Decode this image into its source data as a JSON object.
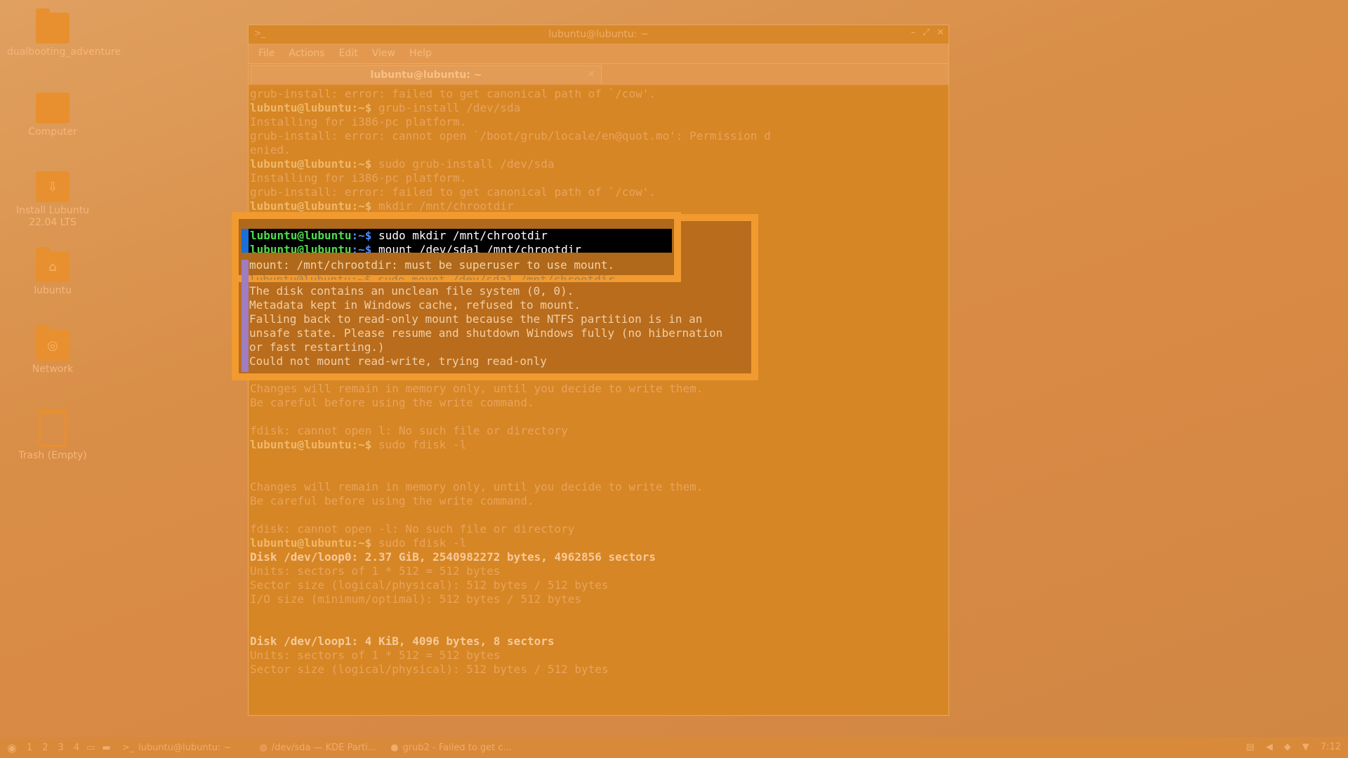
{
  "desktop": {
    "icons": [
      {
        "label": "dualbooting_adventure",
        "icon": "folder-icon"
      },
      {
        "label": "Computer",
        "icon": "computer-icon"
      },
      {
        "label": "Install Lubuntu 22.04 LTS",
        "icon": "installer-icon"
      },
      {
        "label": "lubuntu",
        "icon": "home-folder-icon"
      },
      {
        "label": "Network",
        "icon": "network-icon"
      },
      {
        "label": "Trash (Empty)",
        "icon": "trash-icon"
      }
    ]
  },
  "window": {
    "title": "lubuntu@lubuntu: ~",
    "menu": [
      "File",
      "Actions",
      "Edit",
      "View",
      "Help"
    ],
    "tab_label": "lubuntu@lubuntu: ~"
  },
  "terminal": {
    "prompt": "lubuntu@lubuntu:~$",
    "lines": [
      {
        "t": "grub-install: error: failed to get canonical path of `/cow'."
      },
      {
        "t": "lubuntu@lubuntu:~$ grub-install /dev/sda",
        "p": true
      },
      {
        "t": "Installing for i386-pc platform."
      },
      {
        "t": "grub-install: error: cannot open `/boot/grub/locale/en@quot.mo': Permission d"
      },
      {
        "t": "enied."
      },
      {
        "t": "lubuntu@lubuntu:~$ sudo grub-install /dev/sda",
        "p": true
      },
      {
        "t": "Installing for i386-pc platform."
      },
      {
        "t": "grub-install: error: failed to get canonical path of `/cow'."
      },
      {
        "t": "lubuntu@lubuntu:~$ mkdir /mnt/chrootdir",
        "p": true
      },
      {
        "t": ""
      },
      {
        "t": ""
      },
      {
        "t": ""
      },
      {
        "t": ""
      },
      {
        "t": ""
      },
      {
        "t": ""
      },
      {
        "t": ""
      },
      {
        "t": ""
      },
      {
        "t": ""
      },
      {
        "t": ""
      },
      {
        "t": ""
      },
      {
        "t": ""
      },
      {
        "t": "Changes will remain in memory only, until you decide to write them."
      },
      {
        "t": "Be careful before using the write command."
      },
      {
        "t": ""
      },
      {
        "t": "fdisk: cannot open l: No such file or directory"
      },
      {
        "t": "lubuntu@lubuntu:~$ sudo fdisk -l",
        "p": true
      },
      {
        "t": ""
      },
      {
        "t": ""
      },
      {
        "t": "Changes will remain in memory only, until you decide to write them."
      },
      {
        "t": "Be careful before using the write command."
      },
      {
        "t": ""
      },
      {
        "t": "fdisk: cannot open -l: No such file or directory"
      },
      {
        "t": "lubuntu@lubuntu:~$ sudo fdisk -l",
        "p": true
      },
      {
        "t": "Disk /dev/loop0: 2.37 GiB, 2540982272 bytes, 4962856 sectors",
        "b": true
      },
      {
        "t": "Units: sectors of 1 * 512 = 512 bytes"
      },
      {
        "t": "Sector size (logical/physical): 512 bytes / 512 bytes"
      },
      {
        "t": "I/O size (minimum/optimal): 512 bytes / 512 bytes"
      },
      {
        "t": ""
      },
      {
        "t": ""
      },
      {
        "t": "Disk /dev/loop1: 4 KiB, 4096 bytes, 8 sectors",
        "b": true
      },
      {
        "t": "Units: sectors of 1 * 512 = 512 bytes"
      },
      {
        "t": "Sector size (logical/physical): 512 bytes / 512 bytes"
      }
    ]
  },
  "highlight": {
    "cmd1": "sudo mkdir /mnt/chrootdir",
    "cmd2": "mount /dev/sda1 /mnt/chrootdir",
    "prompt_user": "lubuntu@lubuntu",
    "prompt_path": ":~$",
    "mount_error": "mount: /mnt/chrootdir: must be superuser to use mount.",
    "mount_retry": "lubuntu@lubuntu:~$ sudo mount /dev/sda1 /mnt/chrootdir",
    "messages": [
      "The disk contains an unclean file system (0, 0).",
      "Metadata kept in Windows cache, refused to mount.",
      "Falling back to read-only mount because the NTFS partition is in an",
      "unsafe state. Please resume and shutdown Windows fully (no hibernation",
      "or fast restarting.)",
      "Could not mount read-write, trying read-only"
    ]
  },
  "taskbar": {
    "workspaces": [
      "1",
      "2",
      "3",
      "4"
    ],
    "tasks": [
      {
        "label": "lubuntu@lubuntu: ~",
        "icon": "terminal-icon"
      },
      {
        "label": "/dev/sda — KDE Parti...",
        "icon": "partition-manager-icon"
      },
      {
        "label": "grub2 - Failed to get c...",
        "icon": "firefox-icon"
      }
    ],
    "clock": "7:12"
  }
}
